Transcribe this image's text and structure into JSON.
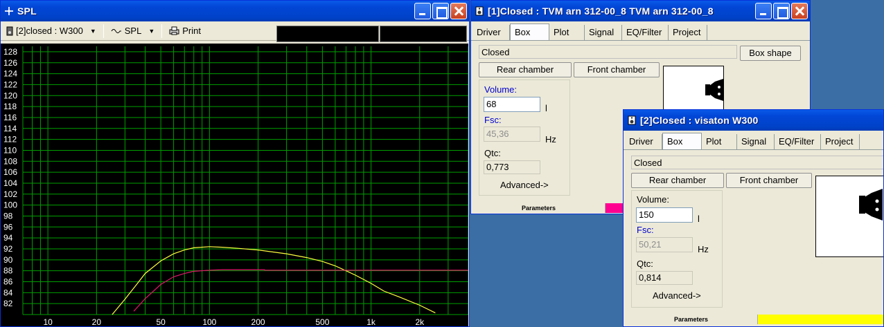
{
  "spl_window": {
    "title": "SPL",
    "driver_select": "[2]closed : W300",
    "curve_select": "SPL",
    "print_label": "Print"
  },
  "chart_data": {
    "type": "line",
    "title": "",
    "xlabel": "",
    "ylabel": "",
    "x_scale": "log",
    "xlim": [
      7,
      4000
    ],
    "ylim": [
      80,
      129
    ],
    "x_ticks": [
      10,
      20,
      50,
      100,
      200,
      500,
      1000,
      2000
    ],
    "x_tick_labels": [
      "10",
      "20",
      "50",
      "100",
      "200",
      "500",
      "1k",
      "2k"
    ],
    "y_ticks": [
      82,
      84,
      86,
      88,
      90,
      92,
      94,
      96,
      98,
      100,
      102,
      104,
      106,
      108,
      110,
      112,
      114,
      116,
      118,
      120,
      122,
      124,
      126,
      128
    ],
    "grid": true,
    "colors": {
      "background": "#000000",
      "grid": "#00a000",
      "labels": "#ffffff"
    },
    "series": [
      {
        "color": "#ffff40",
        "x": [
          25,
          30,
          35,
          40,
          50,
          60,
          70,
          80,
          100,
          120,
          150,
          200,
          300,
          400,
          500,
          600,
          700,
          800,
          1000,
          1200,
          1500,
          2000,
          2500
        ],
        "y": [
          80,
          82.8,
          85.3,
          87.5,
          89.8,
          91.1,
          91.8,
          92.2,
          92.4,
          92.3,
          92.1,
          91.8,
          91.1,
          90.4,
          89.7,
          88.9,
          88.0,
          87.2,
          85.7,
          84.3,
          83.2,
          81.7,
          80.3
        ]
      },
      {
        "color": "#e0186a",
        "x": [
          34,
          40,
          50,
          60,
          70,
          80,
          100,
          120,
          150,
          200,
          219,
          220,
          300,
          500,
          1000,
          2000,
          4000
        ],
        "y": [
          80.6,
          82.9,
          85.5,
          86.9,
          87.5,
          87.9,
          88.1,
          88.2,
          88.2,
          88.2,
          88.2,
          88.1,
          88.1,
          88.1,
          88.1,
          88.1,
          88.1
        ]
      }
    ]
  },
  "win1": {
    "title": "[1]Closed : TVM arn 312-00_8 TVM arn 312-00_8",
    "tabs": [
      "Driver",
      "Box",
      "Plot",
      "Signal",
      "EQ/Filter",
      "Project"
    ],
    "box_type": "Closed",
    "box_shape_button": "Box shape",
    "rear_chamber": "Rear chamber",
    "front_chamber": "Front chamber",
    "volume_label": "Volume:",
    "volume_value": "68",
    "volume_unit": "l",
    "fsc_label": "Fsc:",
    "fsc_value": "45,36",
    "fsc_unit": "Hz",
    "qtc_label": "Qtc:",
    "qtc_value": "0,773",
    "advanced": "Advanced->",
    "status": "Parameters",
    "status_color": "#ff0090"
  },
  "win2": {
    "title": "[2]Closed : visaton W300",
    "tabs": [
      "Driver",
      "Box",
      "Plot",
      "Signal",
      "EQ/Filter",
      "Project"
    ],
    "box_type": "Closed",
    "rear_chamber": "Rear chamber",
    "front_chamber": "Front chamber",
    "volume_label": "Volume:",
    "volume_value": "150",
    "volume_unit": "l",
    "fsc_label": "Fsc:",
    "fsc_value": "50,21",
    "fsc_unit": "Hz",
    "qtc_label": "Qtc:",
    "qtc_value": "0,814",
    "advanced": "Advanced->",
    "status": "Parameters",
    "status_color": "#ffff00"
  }
}
